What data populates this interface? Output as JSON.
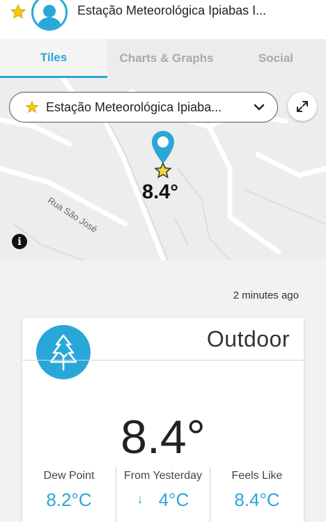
{
  "header": {
    "station_title": "Estação Meteorológica Ipiabas I...",
    "star_icon": "star-icon",
    "avatar_icon": "user-avatar-icon"
  },
  "tabs": [
    {
      "label": "Tiles",
      "active": true
    },
    {
      "label": "Charts & Graphs",
      "active": false
    },
    {
      "label": "Social",
      "active": false
    }
  ],
  "map": {
    "station_select": "Estação Meteorológica Ipiaba...",
    "pin_temperature": "8.4°",
    "street_label": "Rua São José",
    "info_label": "i"
  },
  "updated": "2 minutes ago",
  "card": {
    "title": "Outdoor",
    "icon": "tree-icon",
    "temperature": "8.4°",
    "stats": [
      {
        "label": "Dew Point",
        "value": "8.2°C"
      },
      {
        "label": "From Yesterday",
        "arrow": "↓",
        "value": "4°C"
      },
      {
        "label": "Feels Like",
        "value": "8.4°C"
      }
    ]
  },
  "colors": {
    "accent": "#29a7d8",
    "star": "#f5c518"
  }
}
